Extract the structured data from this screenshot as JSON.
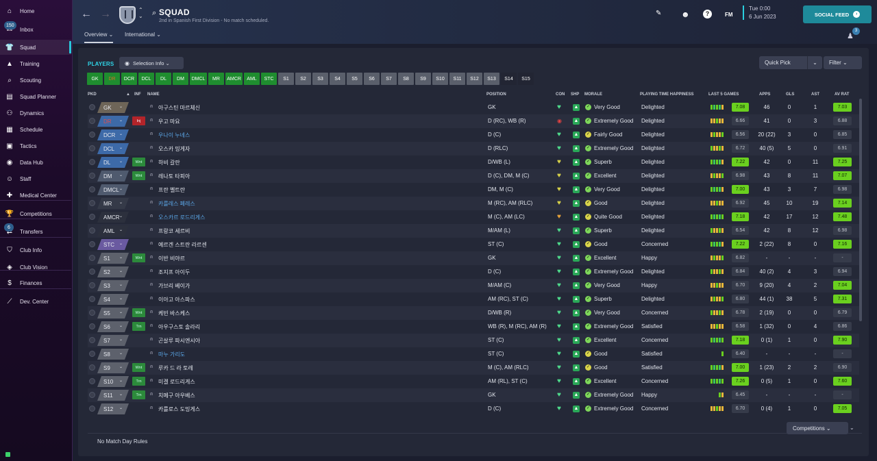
{
  "sidebar": {
    "items": [
      {
        "label": "Home",
        "icon": "⌂"
      },
      {
        "label": "Inbox",
        "icon": "✉",
        "badge": "150"
      },
      {
        "label": "Squad",
        "icon": "👕",
        "active": true
      },
      {
        "label": "Training",
        "icon": "▲"
      },
      {
        "label": "Scouting",
        "icon": "⌕"
      },
      {
        "label": "Squad Planner",
        "icon": "▤"
      },
      {
        "label": "Dynamics",
        "icon": "⚇"
      },
      {
        "label": "Schedule",
        "icon": "▦"
      },
      {
        "label": "Tactics",
        "icon": "▣"
      },
      {
        "label": "Data Hub",
        "icon": "◉"
      },
      {
        "label": "Staff",
        "icon": "☺"
      },
      {
        "label": "Medical Center",
        "icon": "✚"
      },
      {
        "label": "Competitions",
        "icon": "🏆"
      },
      {
        "label": "Transfers",
        "icon": "⇄",
        "badge": "6"
      },
      {
        "label": "Club Info",
        "icon": "⛉"
      },
      {
        "label": "Club Vision",
        "icon": "◈"
      },
      {
        "label": "Finances",
        "icon": "$"
      },
      {
        "label": "Dev. Center",
        "icon": "⟋"
      }
    ]
  },
  "header": {
    "title": "SQUAD",
    "subtitle": "2nd in Spanish First Division - No match scheduled.",
    "tabs": [
      {
        "label": "Overview ⌄",
        "active": true
      },
      {
        "label": "International ⌄",
        "active": false
      }
    ],
    "fm_label": "FM",
    "date_line1": "Tue 0:00",
    "date_line2": "6 Jun 2023",
    "social_label": "SOCIAL FEED",
    "notif_count": "3"
  },
  "panel": {
    "players_label": "PLAYERS",
    "selection_info": "Selection Info ⌄",
    "quick_pick": "Quick Pick",
    "filter": "Filter ⌄",
    "competitions": "Competitions ⌄",
    "no_match_day_rules": "No Match Day Rules",
    "position_tabs": [
      {
        "label": "GK",
        "style": "g"
      },
      {
        "label": "DR",
        "style": "g",
        "dim": true
      },
      {
        "label": "DCR",
        "style": "g"
      },
      {
        "label": "DCL",
        "style": "g"
      },
      {
        "label": "DL",
        "style": "g"
      },
      {
        "label": "DM",
        "style": "g"
      },
      {
        "label": "DMCL",
        "style": "g"
      },
      {
        "label": "MR",
        "style": "g"
      },
      {
        "label": "AMCR",
        "style": "g"
      },
      {
        "label": "AML",
        "style": "g"
      },
      {
        "label": "STC",
        "style": "g"
      },
      {
        "label": "S1",
        "style": "gr"
      },
      {
        "label": "S2",
        "style": "gr"
      },
      {
        "label": "S3",
        "style": "gr"
      },
      {
        "label": "S4",
        "style": "gr"
      },
      {
        "label": "S5",
        "style": "gr"
      },
      {
        "label": "S6",
        "style": "gr"
      },
      {
        "label": "S7",
        "style": "gr"
      },
      {
        "label": "S8",
        "style": "gr"
      },
      {
        "label": "S9",
        "style": "gr"
      },
      {
        "label": "S10",
        "style": "gr"
      },
      {
        "label": "S11",
        "style": "gr"
      },
      {
        "label": "S12",
        "style": "gr"
      },
      {
        "label": "S13",
        "style": "gr"
      },
      {
        "label": "S14",
        "style": "dk"
      },
      {
        "label": "S15",
        "style": "dk"
      }
    ],
    "columns": {
      "pkd": "PKD",
      "inf": "INF",
      "name": "NAME",
      "position": "POSITION",
      "con": "CON",
      "shp": "SHP",
      "morale": "MORALE",
      "pth": "PLAYING TIME HAPPINESS",
      "last5": "LAST 5 GAMES",
      "apps": "APPS",
      "gls": "GLS",
      "ast": "AST",
      "avrat": "AV RAT"
    },
    "sort_indicator": "▲"
  },
  "players": [
    {
      "pkd": "GK",
      "pkd_color": "#6e6558",
      "inf": "",
      "name": "아구스틴 마르체신",
      "link": false,
      "pos": "GK",
      "con": "heart",
      "morale": "Very Good",
      "pth": "Delighted",
      "l5": "7.08",
      "l5hi": true,
      "apps": "46",
      "gls": "0",
      "ast": "1",
      "avr": "7.03",
      "avrhi": true
    },
    {
      "pkd": "DR",
      "pkd_color": "#3d6aa8",
      "pkd_text": "#e05050",
      "inf": "Inj",
      "name": "우고 마요",
      "link": false,
      "pos": "D (RC), WB (R)",
      "con": "red",
      "morale": "Extremely Good",
      "pth": "Delighted",
      "l5": "6.66",
      "l5hi": false,
      "apps": "41",
      "gls": "0",
      "ast": "3",
      "avr": "6.88",
      "avrhi": false
    },
    {
      "pkd": "DCR",
      "pkd_color": "#3d6aa8",
      "inf": "",
      "name": "우나이 누녜스",
      "link": true,
      "pos": "D (C)",
      "con": "heart",
      "morale": "Fairly Good",
      "pth": "Delighted",
      "l5": "6.56",
      "l5hi": false,
      "apps": "20 (22)",
      "gls": "3",
      "ast": "0",
      "avr": "6.85",
      "avrhi": false
    },
    {
      "pkd": "DCL",
      "pkd_color": "#3d6aa8",
      "inf": "",
      "name": "오스카 밍게자",
      "link": false,
      "pos": "D (RLC)",
      "con": "heart",
      "morale": "Extremely Good",
      "pth": "Delighted",
      "l5": "6.72",
      "l5hi": false,
      "apps": "40 (5)",
      "gls": "5",
      "ast": "0",
      "avr": "6.91",
      "avrhi": false
    },
    {
      "pkd": "DL",
      "pkd_color": "#3d6aa8",
      "inf": "Wnt",
      "name": "하비 갈란",
      "link": false,
      "pos": "D/WB (L)",
      "con": "y",
      "morale": "Superb",
      "pth": "Delighted",
      "l5": "7.22",
      "l5hi": true,
      "apps": "42",
      "gls": "0",
      "ast": "11",
      "avr": "7.25",
      "avrhi": true
    },
    {
      "pkd": "DM",
      "pkd_color": "#4f5a6e",
      "inf": "Wnt",
      "name": "레나토 타피아",
      "link": false,
      "pos": "D (C), DM, M (C)",
      "con": "y",
      "morale": "Excellent",
      "pth": "Delighted",
      "l5": "6.98",
      "l5hi": false,
      "apps": "43",
      "gls": "8",
      "ast": "11",
      "avr": "7.07",
      "avrhi": true
    },
    {
      "pkd": "DMCL",
      "pkd_color": "#4f5a6e",
      "inf": "",
      "name": "프란 벨트란",
      "link": false,
      "pos": "DM, M (C)",
      "con": "y",
      "morale": "Very Good",
      "pth": "Delighted",
      "l5": "7.00",
      "l5hi": true,
      "apps": "43",
      "gls": "3",
      "ast": "7",
      "avr": "6.98",
      "avrhi": false
    },
    {
      "pkd": "MR",
      "pkd_color": "#353a48",
      "inf": "",
      "name": "카를레스 페레스",
      "link": true,
      "pos": "M (RC), AM (RLC)",
      "con": "y",
      "morale": "Good",
      "pth": "Delighted",
      "l5": "6.92",
      "l5hi": false,
      "apps": "45",
      "gls": "10",
      "ast": "19",
      "avr": "7.14",
      "avrhi": true
    },
    {
      "pkd": "AMCR",
      "pkd_color": "#2c303d",
      "inf": "",
      "name": "오스카르 로드리게스",
      "link": true,
      "pos": "M (C), AM (LC)",
      "con": "o",
      "morale": "Quite Good",
      "pth": "Delighted",
      "l5": "7.18",
      "l5hi": true,
      "apps": "42",
      "gls": "17",
      "ast": "12",
      "avr": "7.48",
      "avrhi": true
    },
    {
      "pkd": "AML",
      "pkd_color": "#2c303d",
      "inf": "",
      "name": "프랑코 세르비",
      "link": false,
      "pos": "M/AM (L)",
      "con": "heart",
      "morale": "Superb",
      "pth": "Delighted",
      "l5": "6.54",
      "l5hi": false,
      "apps": "42",
      "gls": "8",
      "ast": "12",
      "avr": "6.98",
      "avrhi": false
    },
    {
      "pkd": "STC",
      "pkd_color": "#6a5aa0",
      "inf": "",
      "name": "예르겐 스트란 라르센",
      "link": false,
      "pos": "ST (C)",
      "con": "heart",
      "morale": "Good",
      "pth": "Concerned",
      "l5": "7.22",
      "l5hi": true,
      "apps": "2 (22)",
      "gls": "8",
      "ast": "0",
      "avr": "7.16",
      "avrhi": true
    },
    {
      "pkd": "S1",
      "pkd_color": "#5d616c",
      "inf": "Wnt",
      "name": "이반 비야르",
      "link": false,
      "pos": "GK",
      "con": "heart",
      "morale": "Excellent",
      "pth": "Happy",
      "l5": "6.82",
      "l5hi": false,
      "apps": "-",
      "gls": "-",
      "ast": "-",
      "avr": "-",
      "avrhi": false
    },
    {
      "pkd": "S2",
      "pkd_color": "#5d616c",
      "inf": "",
      "name": "조지프 아이두",
      "link": false,
      "pos": "D (C)",
      "con": "heart",
      "morale": "Extremely Good",
      "pth": "Delighted",
      "l5": "6.84",
      "l5hi": false,
      "apps": "40 (2)",
      "gls": "4",
      "ast": "3",
      "avr": "6.94",
      "avrhi": false
    },
    {
      "pkd": "S3",
      "pkd_color": "#5d616c",
      "inf": "",
      "name": "가브리 베이가",
      "link": false,
      "pos": "M/AM (C)",
      "con": "heart",
      "morale": "Very Good",
      "pth": "Happy",
      "l5": "6.70",
      "l5hi": false,
      "apps": "9 (20)",
      "gls": "4",
      "ast": "2",
      "avr": "7.04",
      "avrhi": true
    },
    {
      "pkd": "S4",
      "pkd_color": "#5d616c",
      "inf": "",
      "name": "이아고 아스파스",
      "link": false,
      "pos": "AM (RC), ST (C)",
      "con": "heart",
      "morale": "Superb",
      "pth": "Delighted",
      "l5": "6.80",
      "l5hi": false,
      "apps": "44 (1)",
      "gls": "38",
      "ast": "5",
      "avr": "7.31",
      "avrhi": true
    },
    {
      "pkd": "S5",
      "pkd_color": "#5d616c",
      "inf": "Wnt",
      "name": "케빈 바스케스",
      "link": false,
      "pos": "D/WB (R)",
      "con": "heart",
      "morale": "Very Good",
      "pth": "Concerned",
      "l5": "6.78",
      "l5hi": false,
      "apps": "2 (19)",
      "gls": "0",
      "ast": "0",
      "avr": "6.79",
      "avrhi": false
    },
    {
      "pkd": "S6",
      "pkd_color": "#5d616c",
      "inf": "Trn",
      "name": "아우구스토 솔라리",
      "link": false,
      "pos": "WB (R), M (RC), AM (R)",
      "con": "heart",
      "morale": "Extremely Good",
      "pth": "Satisfied",
      "l5": "6.58",
      "l5hi": false,
      "apps": "1 (32)",
      "gls": "0",
      "ast": "4",
      "avr": "6.86",
      "avrhi": false
    },
    {
      "pkd": "S7",
      "pkd_color": "#5d616c",
      "inf": "",
      "name": "곤살루 파시엔시아",
      "link": false,
      "pos": "ST (C)",
      "con": "heart",
      "morale": "Excellent",
      "pth": "Concerned",
      "l5": "7.18",
      "l5hi": true,
      "apps": "0 (1)",
      "gls": "1",
      "ast": "0",
      "avr": "7.90",
      "avrhi": true
    },
    {
      "pkd": "S8",
      "pkd_color": "#5d616c",
      "inf": "",
      "name": "마누 가리도",
      "link": true,
      "pos": "ST (C)",
      "con": "heart",
      "morale": "Good",
      "pth": "Satisfied",
      "l5": "6.40",
      "l5hi": false,
      "apps": "-",
      "gls": "-",
      "ast": "-",
      "avr": "-",
      "avrhi": false
    },
    {
      "pkd": "S9",
      "pkd_color": "#5d616c",
      "inf": "Wnt",
      "name": "루카 드 라 토레",
      "link": false,
      "pos": "M (C), AM (RLC)",
      "con": "heart",
      "morale": "Good",
      "pth": "Satisfied",
      "l5": "7.00",
      "l5hi": true,
      "apps": "1 (23)",
      "gls": "2",
      "ast": "2",
      "avr": "6.90",
      "avrhi": false
    },
    {
      "pkd": "S10",
      "pkd_color": "#5d616c",
      "inf": "Trn",
      "name": "미겔 로드리게스",
      "link": false,
      "pos": "AM (RL), ST (C)",
      "con": "heart",
      "morale": "Excellent",
      "pth": "Concerned",
      "l5": "7.26",
      "l5hi": true,
      "apps": "0 (5)",
      "gls": "1",
      "ast": "0",
      "avr": "7.60",
      "avrhi": true
    },
    {
      "pkd": "S11",
      "pkd_color": "#5d616c",
      "inf": "Trn",
      "name": "치메구 아우베스",
      "link": false,
      "pos": "GK",
      "con": "heart",
      "morale": "Extremely Good",
      "pth": "Happy",
      "l5": "6.45",
      "l5hi": false,
      "apps": "-",
      "gls": "-",
      "ast": "-",
      "avr": "-",
      "avrhi": false
    },
    {
      "pkd": "S12",
      "pkd_color": "#5d616c",
      "inf": "",
      "name": "카를로스 도밍게스",
      "link": false,
      "pos": "D (C)",
      "con": "heart",
      "morale": "Extremely Good",
      "pth": "Concerned",
      "l5": "6.70",
      "l5hi": false,
      "apps": "0 (4)",
      "gls": "1",
      "ast": "0",
      "avr": "7.05",
      "avrhi": true
    }
  ],
  "colors": {
    "accent": "#2fd4e6",
    "good": "#6ad01f",
    "injury": "#b3242a",
    "link": "#5ba7e8"
  }
}
